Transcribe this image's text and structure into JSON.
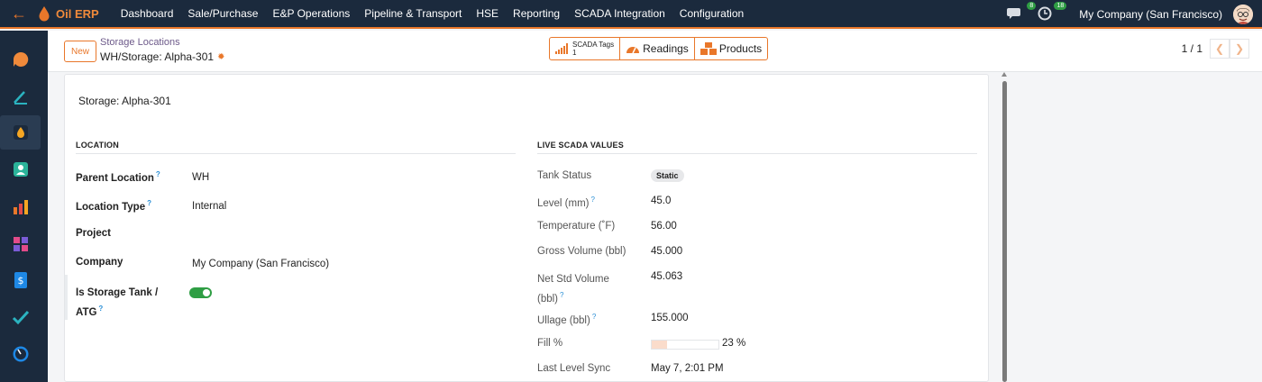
{
  "app": {
    "name": "Oil ERP"
  },
  "topbar": {
    "menu": [
      "Dashboard",
      "Sale/Purchase",
      "E&P Operations",
      "Pipeline & Transport",
      "HSE",
      "Reporting",
      "SCADA Integration",
      "Configuration"
    ],
    "messages_count": "8",
    "activities_count": "18",
    "company": "My Company (San Francisco)"
  },
  "sidebar": {
    "items": [
      "discuss-icon",
      "approvals-icon",
      "inventory-icon",
      "contacts-icon",
      "reporting-icon",
      "apps-icon",
      "documents-icon",
      "project-icon",
      "dashboards-icon"
    ],
    "active_index": 2
  },
  "control": {
    "new_label": "New",
    "breadcrumb_parent": "Storage Locations",
    "breadcrumb_current": "WH/Storage: Alpha-301",
    "smart_buttons": {
      "scada_label": "SCADA Tags",
      "scada_count": "1",
      "readings_label": "Readings",
      "products_label": "Products"
    },
    "pager": "1 / 1"
  },
  "form": {
    "title": "Storage: Alpha-301",
    "location_section": "LOCATION",
    "scada_section": "LIVE SCADA VALUES",
    "left_fields": [
      {
        "label": "Parent Location",
        "help": "?",
        "value": "WH"
      },
      {
        "label": "Location Type",
        "help": "?",
        "value": "Internal"
      },
      {
        "label": "Project",
        "help": "",
        "value": ""
      },
      {
        "label": "Company",
        "help": "",
        "value": "My Company (San Francisco)"
      },
      {
        "label": "Is Storage Tank /",
        "label2": "ATG",
        "help": "?",
        "checked": true
      }
    ],
    "right_fields": [
      {
        "label": "Tank Status",
        "value": "Static"
      },
      {
        "label": "Level (mm)",
        "help": "?",
        "value": "45.0"
      },
      {
        "label": "Temperature (˚F)",
        "value": "56.00"
      },
      {
        "label": "Gross Volume (bbl)",
        "value": "45.000"
      },
      {
        "label": "Net Std Volume",
        "label2": "(bbl)",
        "help": "?",
        "value": "45.063"
      },
      {
        "label": "Ullage (bbl)",
        "help": "?",
        "value": "155.000"
      },
      {
        "label": "Fill %",
        "value": "23 %",
        "fill_fraction": 0.23
      },
      {
        "label": "Last Level Sync",
        "value": "May 7, 2:01 PM"
      }
    ]
  },
  "colors": {
    "topbar": "#1b2a3d",
    "accent": "#e9772a",
    "toggle_on": "#2f9e44",
    "help": "#2b8fd6"
  }
}
